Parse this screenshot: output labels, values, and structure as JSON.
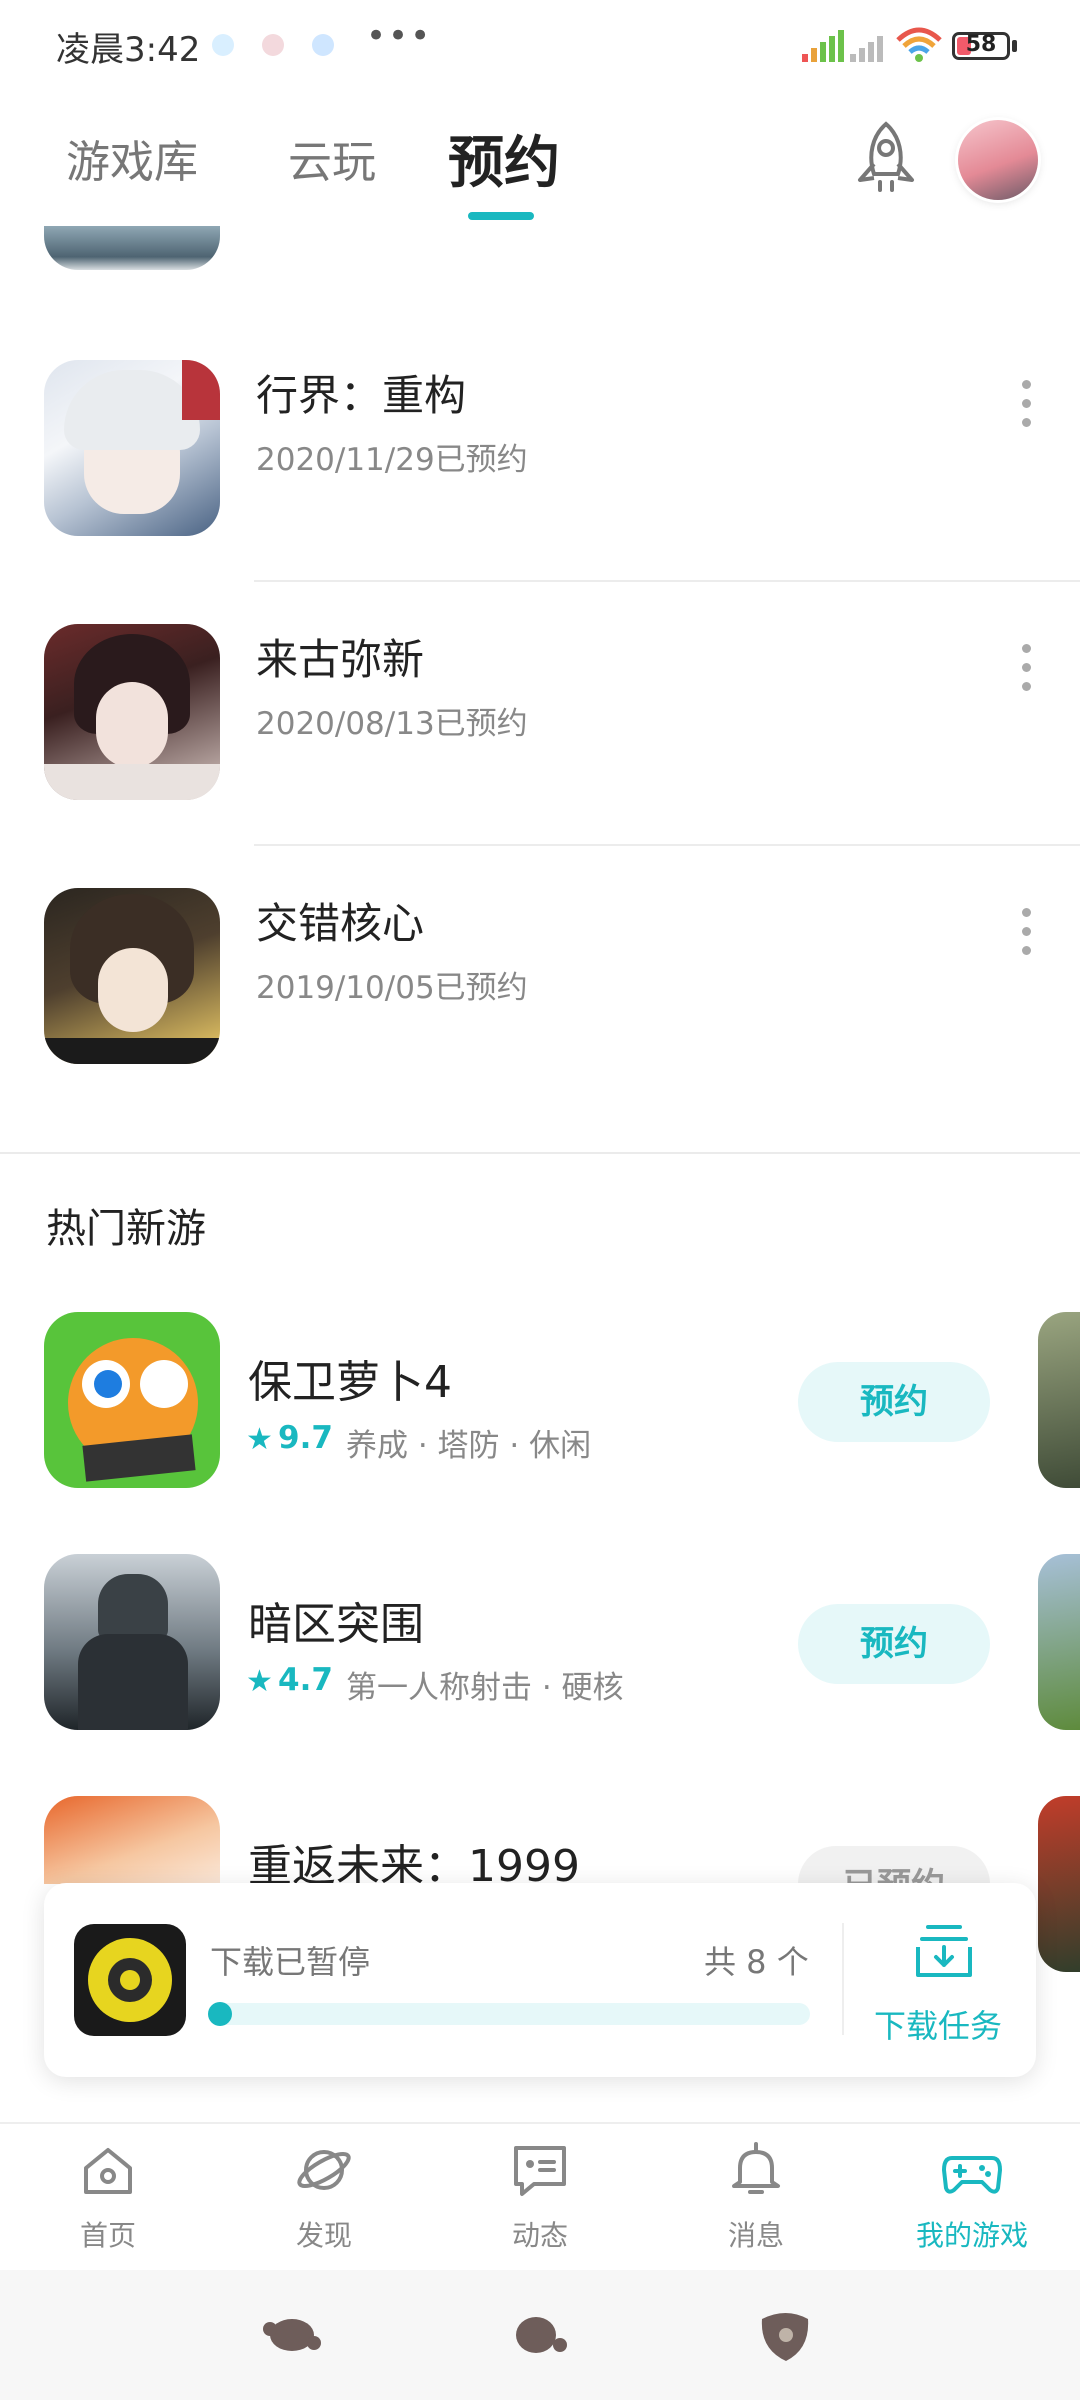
{
  "status_bar": {
    "time": "凌晨3:42",
    "more": "•••",
    "battery": "58"
  },
  "tabs": [
    {
      "label": "游戏库",
      "active": false
    },
    {
      "label": "云玩",
      "active": false
    },
    {
      "label": "预约",
      "active": true
    }
  ],
  "reserved_games": [
    {
      "title": "行界：重构",
      "reserved_text": "2020/11/29已预约",
      "icon": "game-icon-xingjie"
    },
    {
      "title": "来古弥新",
      "reserved_text": "2020/08/13已预约",
      "icon": "game-icon-laigumixin"
    },
    {
      "title": "交错核心",
      "reserved_text": "2019/10/05已预约",
      "icon": "game-icon-jiaocuohexin"
    }
  ],
  "hot_section": {
    "title": "热门新游",
    "games": [
      {
        "title": "保卫萝卜4",
        "rating": "9.7",
        "tags": "养成  ·  塔防  ·  休闲",
        "button": "预约",
        "reserved": false
      },
      {
        "title": "暗区突围",
        "rating": "4.7",
        "tags": "第一人称射击  ·  硬核",
        "button": "预约",
        "reserved": false
      },
      {
        "title": "重返未来：1999",
        "rating": "",
        "tags": "",
        "button": "已预约",
        "reserved": true
      }
    ]
  },
  "download_panel": {
    "status": "下载已暂停",
    "count": "共 8 个",
    "task_label": "下载任务",
    "progress": 0.0
  },
  "bottom_nav": [
    {
      "label": "首页",
      "icon": "home-icon",
      "active": false
    },
    {
      "label": "发现",
      "icon": "discover-icon",
      "active": false
    },
    {
      "label": "动态",
      "icon": "feed-icon",
      "active": false
    },
    {
      "label": "消息",
      "icon": "bell-icon",
      "active": false
    },
    {
      "label": "我的游戏",
      "icon": "gamepad-icon",
      "active": true
    }
  ],
  "colors": {
    "accent": "#19b8c0",
    "reserve_bg": "#e6f8f9"
  }
}
